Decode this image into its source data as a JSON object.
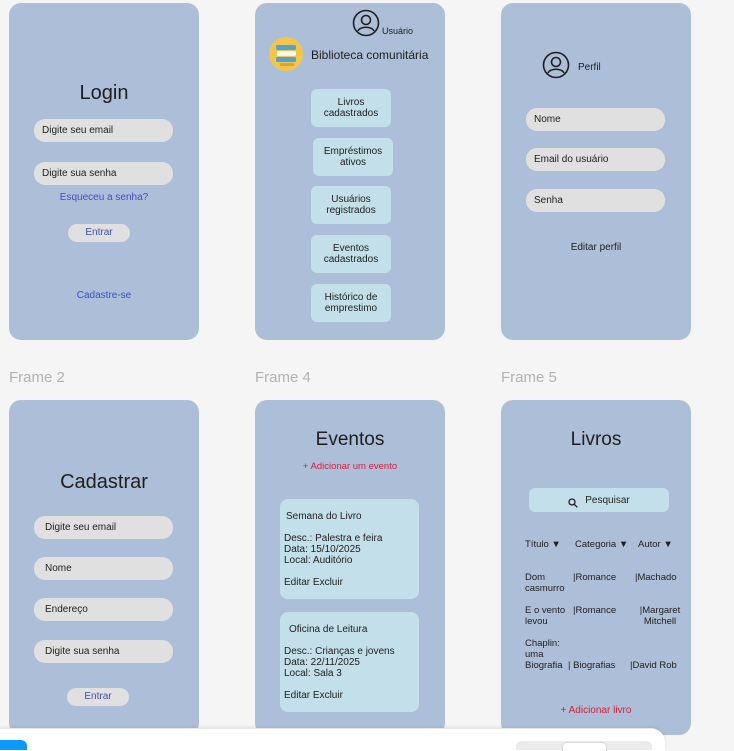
{
  "frames": {
    "login": {
      "title": "Login",
      "email_placeholder": "Digite seu email",
      "password_placeholder": "Digite sua senha",
      "forgot": "Esqueceu a senha?",
      "submit": "Entrar",
      "signup": "Cadastre-se"
    },
    "home": {
      "user_label": "Usuário",
      "app_title": "Biblioteca comunitária",
      "menu": [
        "Livros cadastrados",
        "Empréstimos ativos",
        "Usuários registrados",
        "Eventos cadastrados",
        "Histórico de emprestimo"
      ]
    },
    "profile": {
      "label": "Perfil",
      "fields": [
        "Nome",
        "Email do usuário",
        "Senha"
      ],
      "edit": "Editar perfil"
    },
    "labels": {
      "frame2": "Frame 2",
      "frame4": "Frame 4",
      "frame5": "Frame 5"
    },
    "signup": {
      "title": "Cadastrar",
      "fields": [
        "Digite seu email",
        "Nome",
        "Endereço",
        "Digite sua senha"
      ],
      "submit": "Entrar"
    },
    "events": {
      "title": "Eventos",
      "add": "+ Adicionar um evento",
      "items": [
        {
          "name": "Semana do Livro",
          "desc": "Desc.: Palestra e feira",
          "date": "Data: 15/10/2025",
          "place": "Local: Auditório",
          "actions": "Editar Excluir"
        },
        {
          "name": "Oficina de Leitura",
          "desc": "Desc.: Crianças e jovens",
          "date": "Data: 22/11/2025",
          "place": "Local: Sala 3",
          "actions": "Editar Excluir"
        }
      ]
    },
    "books": {
      "title": "Livros",
      "search": "Pesquisar",
      "headers": [
        "Título ▼",
        "Categoria ▼",
        "Autor ▼"
      ],
      "rows": [
        {
          "title": "Dom casmurro",
          "category": "|Romance",
          "author": "|Machado"
        },
        {
          "title": "E o vento levou",
          "category": "|Romance",
          "author": "|Margaret Mitchell"
        },
        {
          "title": "Chaplin: uma Biografia",
          "category": "| Biografias",
          "author": "|David Rob"
        }
      ],
      "add": "+ Adicionar livro"
    }
  }
}
